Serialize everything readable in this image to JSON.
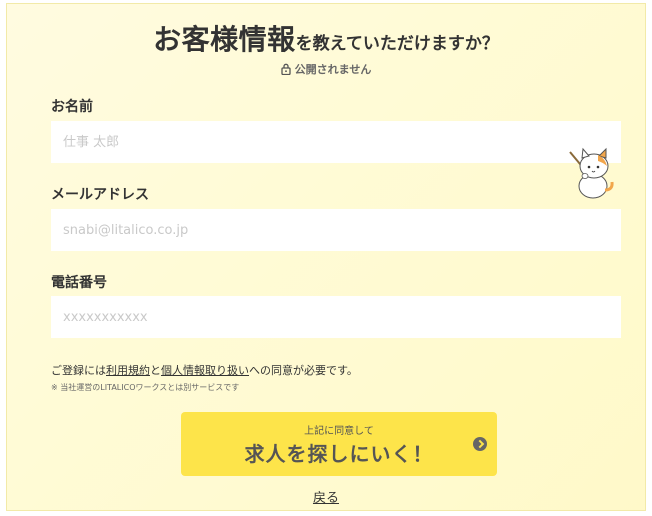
{
  "header": {
    "title_strong": "お客様情報",
    "title_rest": "を教えていただけますか？",
    "privacy_note": "公開されません"
  },
  "form": {
    "name": {
      "label": "お名前",
      "placeholder": "仕事 太郎",
      "value": ""
    },
    "email": {
      "label": "メールアドレス",
      "placeholder": "snabi@litalico.co.jp",
      "value": ""
    },
    "phone": {
      "label": "電話番号",
      "placeholder": "xxxxxxxxxxx",
      "value": ""
    }
  },
  "consent": {
    "prefix": "ご登録には",
    "terms_link": "利用規約",
    "middle": "と",
    "privacy_link": "個人情報取り扱い",
    "suffix": "への同意が必要です。",
    "note": "※ 当社運営のLITALICOワークスとは別サービスです"
  },
  "submit": {
    "sub_label": "上記に同意して",
    "main_label": "求人を探しにいく！",
    "icon": "chevron-right-circle-icon"
  },
  "back_link": "戻る",
  "colors": {
    "background": "#fffbd6",
    "button": "#fde44a",
    "text": "#333333"
  }
}
